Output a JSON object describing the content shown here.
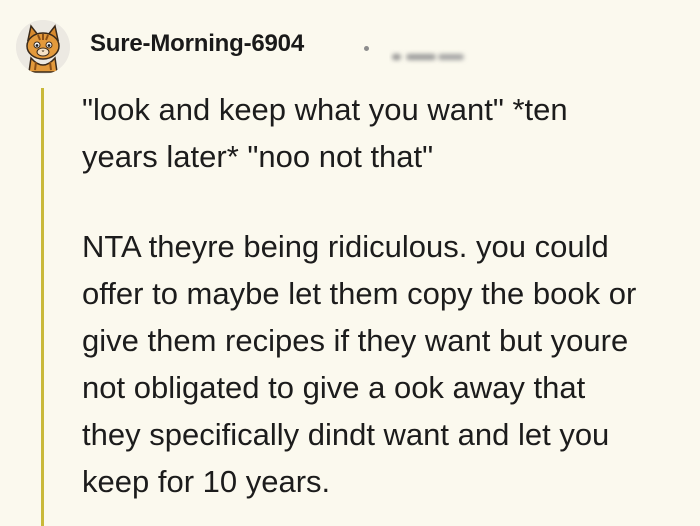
{
  "comment": {
    "username": "Sure-Morning-6904",
    "separator": "·",
    "paragraphs": [
      "\"look and keep what you want\" *ten\nyears later* \"noo not that\"",
      "NTA theyre being ridiculous. you could\noffer to maybe let them copy the book or\ngive them recipes if they want but youre\nnot obligated to give a ook away that\nthey specifically dindt want and let you\nkeep for 10 years."
    ]
  },
  "icons": {
    "avatar": "cat-mascot-avatar"
  },
  "colors": {
    "background": "#fbf9ee",
    "thread_line": "#c9b93a",
    "text": "#1c1c1c"
  }
}
